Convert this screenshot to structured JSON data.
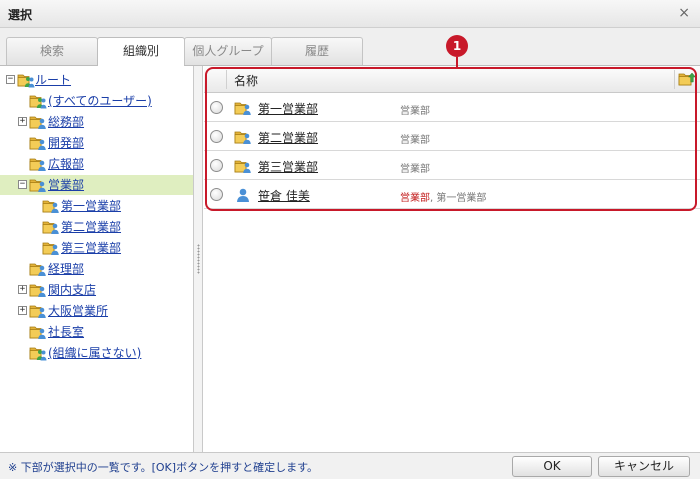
{
  "dialog": {
    "title": "選択",
    "close_glyph": "×"
  },
  "tabs": [
    {
      "label": "検索",
      "active": false
    },
    {
      "label": "組織別",
      "active": true
    },
    {
      "label": "個人グループ",
      "active": false
    },
    {
      "label": "履歴",
      "active": false
    }
  ],
  "tree": {
    "nodes": [
      {
        "label": "ルート",
        "expander": "−",
        "icon": "multi-user-folder-icon"
      },
      {
        "label": "(すべてのユーザー)",
        "icon": "multi-user-folder-icon"
      },
      {
        "label": "総務部",
        "expander": "+",
        "icon": "group-folder-icon"
      },
      {
        "label": "開発部",
        "icon": "group-folder-icon"
      },
      {
        "label": "広報部",
        "icon": "group-folder-icon"
      },
      {
        "label": "営業部",
        "expander": "−",
        "icon": "group-folder-icon",
        "selected": true
      },
      {
        "label": "第一営業部",
        "icon": "group-folder-icon"
      },
      {
        "label": "第二営業部",
        "icon": "group-folder-icon"
      },
      {
        "label": "第三営業部",
        "icon": "group-folder-icon"
      },
      {
        "label": "経理部",
        "icon": "group-folder-icon"
      },
      {
        "label": "関内支店",
        "expander": "+",
        "icon": "group-folder-icon"
      },
      {
        "label": "大阪営業所",
        "expander": "+",
        "icon": "group-folder-icon"
      },
      {
        "label": "社長室",
        "icon": "group-folder-icon"
      },
      {
        "label": "(組織に属さない)",
        "icon": "multi-user-folder-icon"
      }
    ]
  },
  "list": {
    "header": {
      "name_label": "名称",
      "folder_up_icon": "folder-up-icon"
    },
    "rows": [
      {
        "name": "第一営業部",
        "icon": "group-folder-icon",
        "org_primary": "営業部",
        "org_secondary": ""
      },
      {
        "name": "第二営業部",
        "icon": "group-folder-icon",
        "org_primary": "営業部",
        "org_secondary": ""
      },
      {
        "name": "第三営業部",
        "icon": "group-folder-icon",
        "org_primary": "営業部",
        "org_secondary": ""
      },
      {
        "name": "笹倉 佳美",
        "icon": "user-icon",
        "org_primary": "営業部",
        "org_secondary": ", 第一営業部"
      }
    ]
  },
  "callout": {
    "number": "1",
    "color": "#c8192a"
  },
  "footer": {
    "note": "※ 下部が選択中の一覧です。[OK]ボタンを押すと確定します。",
    "ok_label": "OK",
    "cancel_label": "キャンセル"
  },
  "colors": {
    "selected_row": "#dfeec0",
    "link": "#1a3ea8",
    "accent_red": "#c21b1b"
  }
}
